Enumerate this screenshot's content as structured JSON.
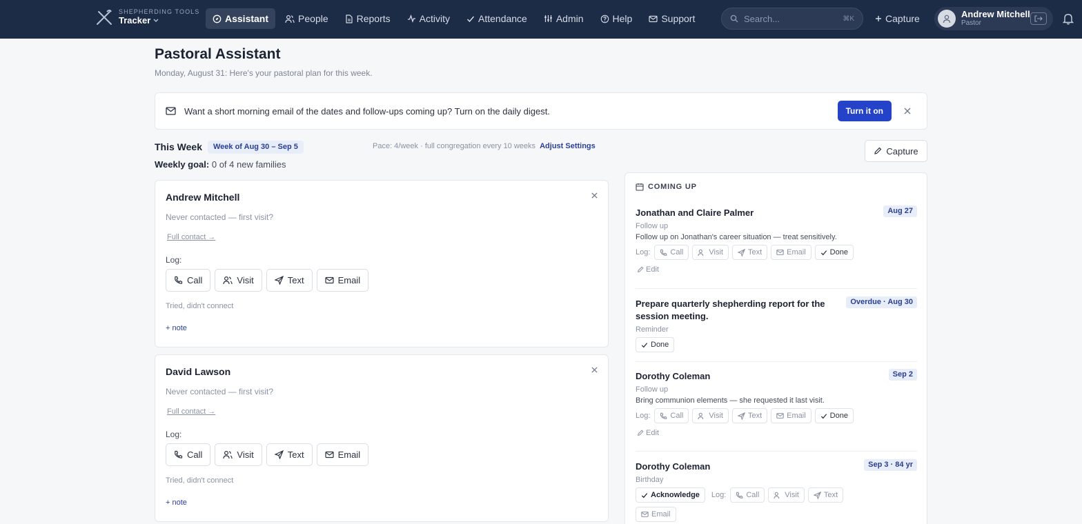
{
  "brand": {
    "subtitle": "SHEPHERDING TOOLS",
    "name": "Tracker"
  },
  "nav": [
    {
      "label": "Assistant",
      "icon": "compass-icon",
      "active": true
    },
    {
      "label": "People",
      "icon": "people-icon"
    },
    {
      "label": "Reports",
      "icon": "document-icon"
    },
    {
      "label": "Activity",
      "icon": "activity-icon"
    },
    {
      "label": "Attendance",
      "icon": "check-icon"
    },
    {
      "label": "Admin",
      "icon": "sliders-icon"
    },
    {
      "label": "Help",
      "icon": "help-icon"
    },
    {
      "label": "Support",
      "icon": "mail-icon"
    }
  ],
  "search": {
    "placeholder": "Search...",
    "shortcut": "⌘K"
  },
  "topbar": {
    "capture_label": "Capture"
  },
  "user": {
    "name": "Andrew Mitchell",
    "role": "Pastor"
  },
  "header": {
    "title": "Pastoral Assistant",
    "subtitle": "Monday, August 31: Here's your pastoral plan for this week."
  },
  "banner": {
    "text": "Want a short morning email of the dates and follow-ups coming up? Turn on the daily digest.",
    "button": "Turn it on"
  },
  "week": {
    "label": "This Week",
    "range": "Week of Aug 30 – Sep 5",
    "pace": "Pace: 4/week · full congregation every 10 weeks",
    "adjust": "Adjust Settings",
    "goal_label": "Weekly goal:",
    "goal_value": "0 of 4 new families",
    "capture": "Capture"
  },
  "cards": [
    {
      "name": "Andrew Mitchell",
      "status": "Never contacted — first visit?",
      "link": "Full contact →",
      "log_label": "Log:",
      "actions": [
        "Call",
        "Visit",
        "Text",
        "Email"
      ],
      "tried": "Tried, didn't connect",
      "note": "+ note"
    },
    {
      "name": "David Lawson",
      "status": "Never contacted — first visit?",
      "link": "Full contact →",
      "log_label": "Log:",
      "actions": [
        "Call",
        "Visit",
        "Text",
        "Email"
      ],
      "tried": "Tried, didn't connect",
      "note": "+ note"
    }
  ],
  "coming_up": {
    "heading": "COMING UP",
    "log_label": "Log:",
    "edit_label": "Edit",
    "items": [
      {
        "title": "Jonathan and Claire Palmer",
        "date": "Aug 27",
        "type": "Follow up",
        "note": "Follow up on Jonathan's career situation — treat sensitively.",
        "actions": [
          "Call",
          "Visit",
          "Text",
          "Email",
          "Done"
        ]
      },
      {
        "title": "Prepare quarterly shepherding report for the session meeting.",
        "date": "Overdue · Aug 30",
        "type": "Reminder",
        "actions": [
          "Done"
        ]
      },
      {
        "title": "Dorothy Coleman",
        "date": "Sep 2",
        "type": "Follow up",
        "note": "Bring communion elements — she requested it last visit.",
        "actions": [
          "Call",
          "Visit",
          "Text",
          "Email",
          "Done"
        ]
      },
      {
        "title": "Dorothy Coleman",
        "date": "Sep 3 · 84 yr",
        "type": "Birthday",
        "acknowledge": "Acknowledge",
        "actions": [
          "Call",
          "Visit",
          "Text",
          "Email"
        ]
      }
    ]
  },
  "colors": {
    "topbar": "#1c2b46",
    "accent": "#2543c8",
    "badge_bg": "#e7edf9",
    "badge_text": "#2a3f8f"
  }
}
